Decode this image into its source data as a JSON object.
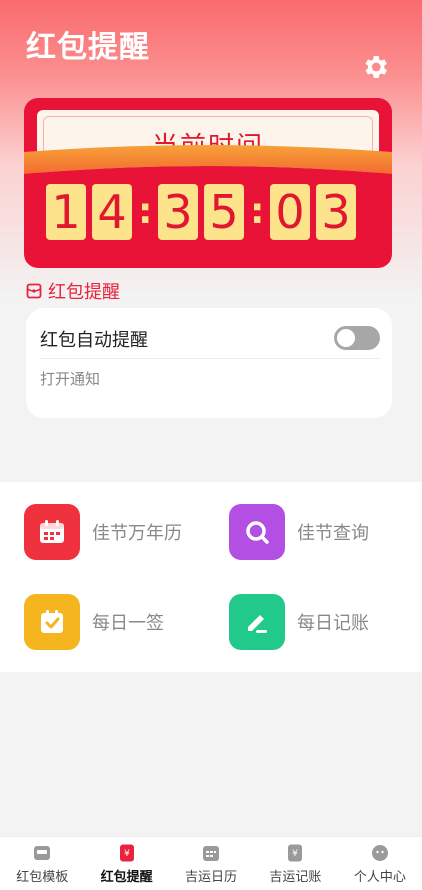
{
  "header": {
    "title": "红包提醒"
  },
  "clock": {
    "title": "-当前时间-",
    "hour_d1": "1",
    "hour_d2": "4",
    "min_d1": "3",
    "min_d2": "5",
    "sec_d1": "0",
    "sec_d2": "3",
    "separator": ":"
  },
  "section": {
    "label": "红包提醒"
  },
  "setting": {
    "title": "红包自动提醒",
    "toggle_on": false,
    "subtitle": "打开通知"
  },
  "tools": [
    {
      "label": "佳节万年历",
      "icon": "calendar-icon",
      "color": "#f0323f"
    },
    {
      "label": "佳节查询",
      "icon": "search-icon",
      "color": "#b44fe4"
    },
    {
      "label": "每日一签",
      "icon": "checklist-icon",
      "color": "#f4b51e"
    },
    {
      "label": "每日记账",
      "icon": "edit-icon",
      "color": "#21c98a"
    }
  ],
  "tabbar": [
    {
      "label": "红包模板",
      "icon": "template-icon",
      "active": false
    },
    {
      "label": "红包提醒",
      "icon": "red-envelope-icon",
      "active": true
    },
    {
      "label": "吉运日历",
      "icon": "calendar-icon",
      "active": false
    },
    {
      "label": "吉运记账",
      "icon": "ledger-icon",
      "active": false
    },
    {
      "label": "个人中心",
      "icon": "profile-icon",
      "active": false
    }
  ],
  "colors": {
    "accent": "#e91237",
    "digit_bg": "#fde38c"
  }
}
